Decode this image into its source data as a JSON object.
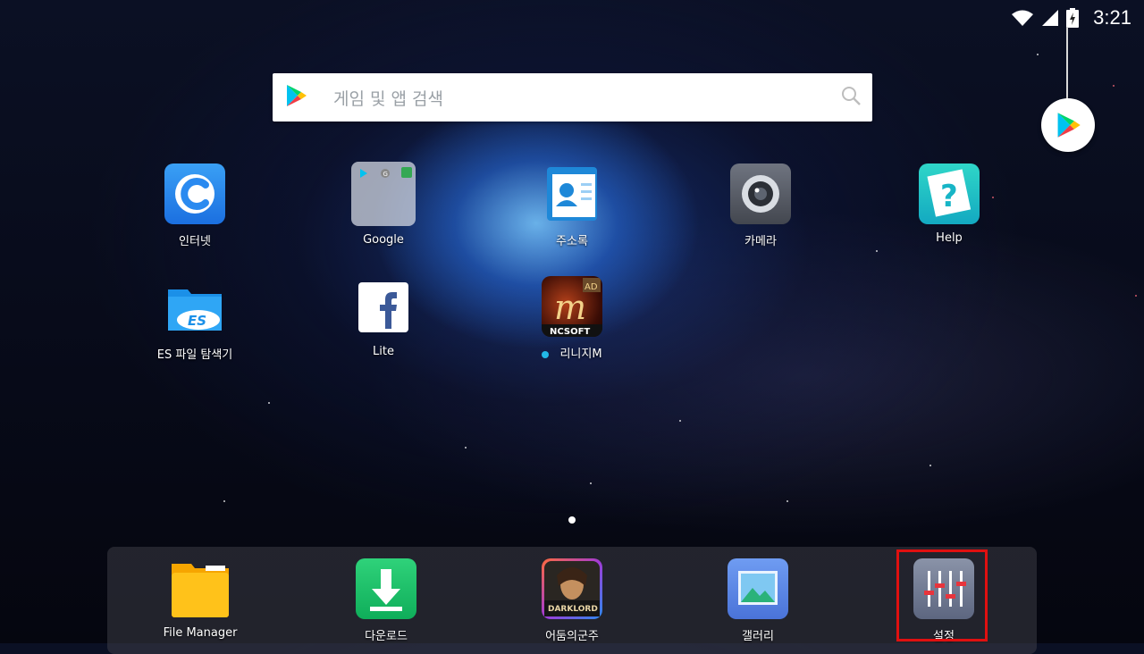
{
  "status_bar": {
    "time": "3:21",
    "icons": [
      "wifi-icon",
      "signal-icon",
      "battery-charging-icon"
    ]
  },
  "search": {
    "placeholder": "게임 및 앱 검색"
  },
  "apps": [
    {
      "label": "인터넷",
      "icon": "browser-icon"
    },
    {
      "label": "Google",
      "icon": "google-folder-icon"
    },
    {
      "label": "주소록",
      "icon": "contacts-icon"
    },
    {
      "label": "카메라",
      "icon": "camera-icon"
    },
    {
      "label": "Help",
      "icon": "help-icon"
    },
    {
      "label": "ES 파일 탐색기",
      "icon": "es-file-explorer-icon"
    },
    {
      "label": "Lite",
      "icon": "facebook-lite-icon"
    },
    {
      "label": "리니지M",
      "icon": "lineage-m-icon",
      "new": true
    }
  ],
  "dock": [
    {
      "label": "File Manager",
      "icon": "folder-icon"
    },
    {
      "label": "다운로드",
      "icon": "download-icon"
    },
    {
      "label": "어둠의군주",
      "icon": "darklord-icon"
    },
    {
      "label": "갤러리",
      "icon": "gallery-icon"
    },
    {
      "label": "설정",
      "icon": "settings-icon",
      "highlighted": true
    }
  ],
  "lineage_badge": "AD",
  "lineage_brand": "NCSOFT",
  "darklord_brand": "DARKLORD",
  "colors": {
    "highlight": "#e01010",
    "new_dot": "#22b8e6"
  }
}
